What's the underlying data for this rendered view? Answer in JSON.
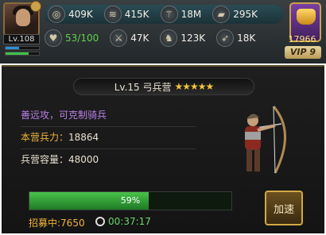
{
  "player": {
    "level": "Lv.108"
  },
  "resources_top": [
    {
      "icon": "silver-coin-icon",
      "glyph": "◎",
      "value": "409K"
    },
    {
      "icon": "wood-icon",
      "glyph": "≋",
      "value": "415K"
    },
    {
      "icon": "wheat-icon",
      "glyph": "⚚",
      "value": "18M"
    },
    {
      "icon": "iron-icon",
      "glyph": "▰",
      "value": "295K"
    }
  ],
  "resources_bottom": [
    {
      "icon": "heart-icon",
      "glyph": "♥",
      "value": "53/100"
    },
    {
      "icon": "sword-icon",
      "glyph": "⚔",
      "value": "47K"
    },
    {
      "icon": "horse-icon",
      "glyph": "♞",
      "value": "123K"
    },
    {
      "icon": "bow-icon",
      "glyph": "➶",
      "value": "18K"
    }
  ],
  "gold": {
    "value": "17966"
  },
  "vip": {
    "label": "VIP 9"
  },
  "barracks": {
    "title": "Lv.15 弓兵营",
    "stars": "★★★★★",
    "description": "善远攻，可克制骑兵",
    "troops_label": "本营兵力：",
    "troops_value": "18864",
    "capacity_label": "兵营容量：",
    "capacity_value": "48000"
  },
  "training": {
    "progress": 0.59,
    "progress_text": "59%",
    "recruiting": "招募中:7650",
    "timer": "00:37:17",
    "speed_button": "加速"
  }
}
